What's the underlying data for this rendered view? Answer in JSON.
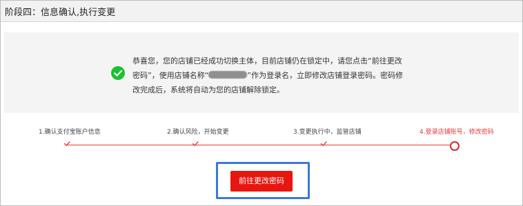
{
  "stage": {
    "title": "阶段四：信息确认,执行变更"
  },
  "notice": {
    "icon": "success-check-icon",
    "text_before_name": "恭喜您，您的店铺已经成功切换主体，目前店铺仍在锁定中，请您点击“前往更改密码”，使用店铺名称“",
    "text_after_name": "”作为登录名，立即修改店铺登录密码。密码修改完成后，系统将自动为您的店铺解除锁定。"
  },
  "steps": [
    {
      "label": "1.确认支付宝账户信息",
      "status": "done"
    },
    {
      "label": "2.确认风险，开始变更",
      "status": "done"
    },
    {
      "label": "3.变更执行中，监管店铺",
      "status": "done"
    },
    {
      "label": "4.登录店铺账号，修改密码",
      "status": "current"
    }
  ],
  "actions": {
    "primary_label": "前往更改密码"
  },
  "colors": {
    "accent_red": "#e23b3b",
    "button_red": "#e9150f",
    "success_green": "#1ac130",
    "focus_blue": "#3b78d8",
    "panel_gray": "#f4f4f4"
  }
}
